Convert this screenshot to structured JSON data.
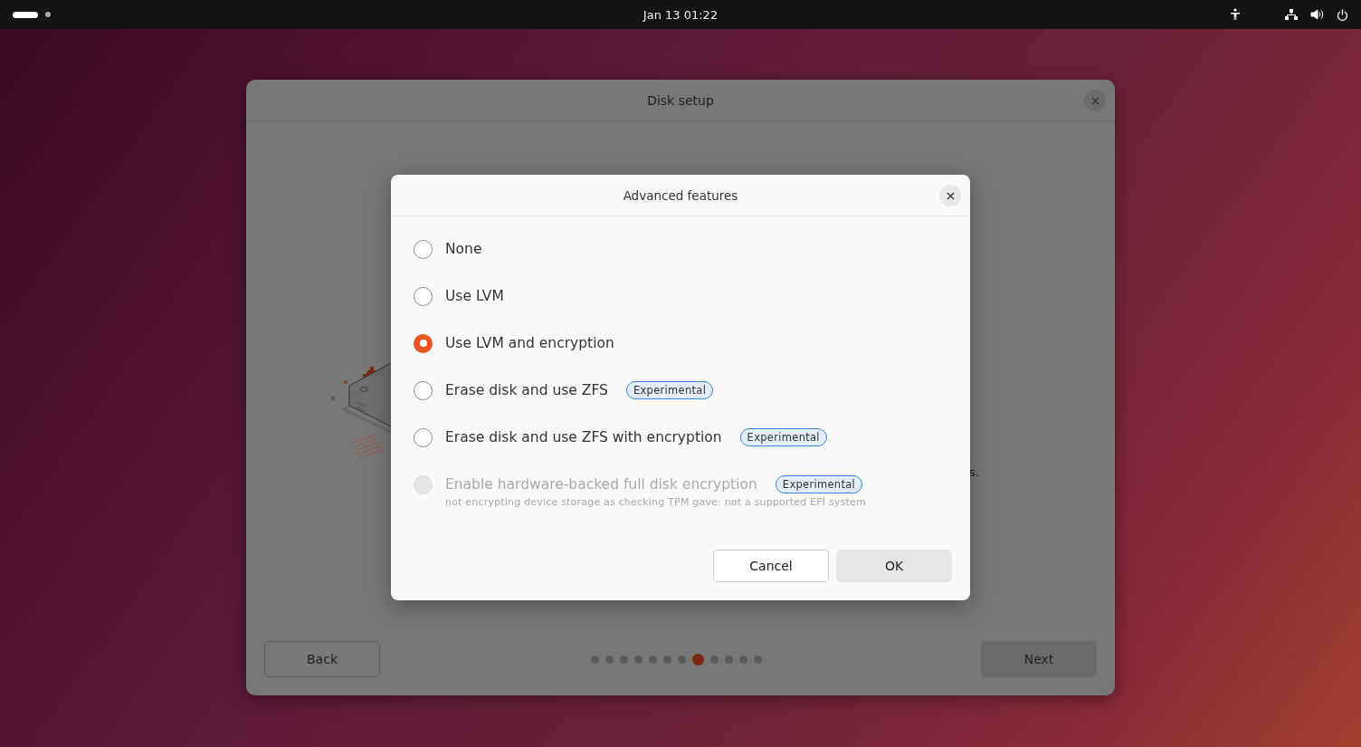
{
  "top_bar": {
    "clock": "Jan 13  01:22"
  },
  "window": {
    "title": "Disk setup",
    "body_fragment": "s.",
    "back_button": "Back",
    "next_button": "Next",
    "steps": [
      {
        "selected": false
      },
      {
        "selected": false
      },
      {
        "selected": false
      },
      {
        "selected": false
      },
      {
        "selected": false
      },
      {
        "selected": false
      },
      {
        "selected": false
      },
      {
        "selected": true
      },
      {
        "selected": false
      },
      {
        "selected": false
      },
      {
        "selected": false
      },
      {
        "selected": false
      }
    ]
  },
  "dialog": {
    "title": "Advanced features",
    "options": [
      {
        "label": "None",
        "selected": false,
        "disabled": false
      },
      {
        "label": "Use LVM",
        "selected": false,
        "disabled": false
      },
      {
        "label": "Use LVM and encryption",
        "selected": true,
        "disabled": false
      },
      {
        "label": "Erase disk and use ZFS",
        "selected": false,
        "disabled": false,
        "badge": "Experimental"
      },
      {
        "label": "Erase disk and use ZFS with encryption",
        "selected": false,
        "disabled": false,
        "badge": "Experimental"
      },
      {
        "label": "Enable hardware-backed full disk encryption",
        "selected": false,
        "disabled": true,
        "badge": "Experimental",
        "note": "not encrypting device storage as checking TPM gave: not a supported EFI system"
      }
    ],
    "cancel_button": "Cancel",
    "ok_button": "OK"
  }
}
